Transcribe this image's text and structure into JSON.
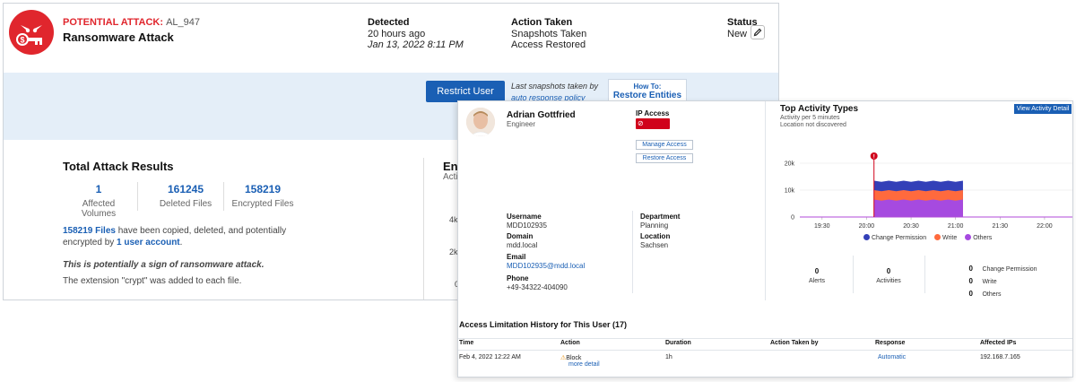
{
  "alert": {
    "type_label": "POTENTIAL ATTACK:",
    "id": "AL_947",
    "title": "Ransomware Attack",
    "detected_label": "Detected",
    "detected_relative": "20 hours ago",
    "detected_datetime": "Jan 13, 2022 8:11 PM",
    "action_label": "Action Taken",
    "action_lines": [
      "Snapshots Taken",
      "Access Restored"
    ],
    "status_label": "Status",
    "status_value": "New",
    "restrict_button": "Restrict User",
    "snapshot_note": "Last snapshots taken by",
    "snapshot_link": "auto response policy",
    "howto_label": "How To:",
    "howto_link": "Restore Entities",
    "icon_color": "#e0262d"
  },
  "results": {
    "title": "Total Attack Results",
    "stats": [
      {
        "value": "1",
        "caption": "Affected Volumes"
      },
      {
        "value": "161245",
        "caption": "Deleted Files"
      },
      {
        "value": "158219",
        "caption": "Encrypted Files"
      }
    ],
    "summary_files": "158219 Files",
    "summary_text": " have been copied, deleted, and potentially encrypted by ",
    "summary_account": "1 user account",
    "summary_end": ".",
    "warning": "This is potentially a sign of ransomware attack.",
    "extension_note": "The extension \"crypt\" was added to each file.",
    "enc_title": "Enc",
    "enc_sub": "Acti",
    "enc_ticks": [
      "4k",
      "2k",
      "0"
    ]
  },
  "user": {
    "name": "Adrian Gottfried",
    "role": "Engineer",
    "ip_access_label": "IP Access",
    "ip_status": "Blocked",
    "manage_button": "Manage Access",
    "restore_button": "Restore Access",
    "fields": {
      "username_label": "Username",
      "username": "MDD102935",
      "domain_label": "Domain",
      "domain": "mdd.local",
      "email_label": "Email",
      "email": "MDD102935@mdd.local",
      "phone_label": "Phone",
      "phone": "+49-34322-404090",
      "department_label": "Department",
      "department": "Planning",
      "location_label": "Location",
      "location": "Sachsen"
    }
  },
  "activity": {
    "title": "Top Activity Types",
    "subtitle1": "Activity per 5 minutes",
    "subtitle2": "Location not discovered",
    "view_button": "View Activity Detail",
    "counts": [
      {
        "value": "0",
        "caption": "Alerts"
      },
      {
        "value": "0",
        "caption": "Activities"
      }
    ],
    "breakdown": [
      {
        "value": "0",
        "label": "Change Permission"
      },
      {
        "value": "0",
        "label": "Write"
      },
      {
        "value": "0",
        "label": "Others"
      }
    ]
  },
  "chart_data": {
    "type": "area",
    "title": "Top Activity Types",
    "x": [
      "19:30",
      "20:00",
      "20:30",
      "21:00",
      "21:30",
      "22:00"
    ],
    "ylim": [
      0,
      20000
    ],
    "y_ticks": [
      "20k",
      "10k",
      "0"
    ],
    "x_ticks": [
      "19:30",
      "20:00",
      "20:30",
      "21:00",
      "21:30",
      "22:00"
    ],
    "series": [
      {
        "name": "Change Permission",
        "color": "#3340b8",
        "start": "20:05",
        "end": "21:05",
        "value_top": 13500
      },
      {
        "name": "Write",
        "color": "#ff6a3d",
        "start": "20:05",
        "end": "21:05",
        "value_top": 10000
      },
      {
        "name": "Others",
        "color": "#a64ae0",
        "start": "20:05",
        "end": "21:05",
        "value_top": 6500
      }
    ],
    "marker": {
      "time": "20:05",
      "label": "!",
      "color": "#d0021b"
    },
    "legend": "bottom"
  },
  "history": {
    "title": "Access Limitation History for This User (17)",
    "columns": [
      "Time",
      "Action",
      "Duration",
      "Action Taken by",
      "Response",
      "Affected IPs"
    ],
    "rows": [
      {
        "time": "Feb 4, 2022 12:22 AM",
        "action": "Block",
        "action_link": "more detail",
        "duration": "1h",
        "taken_by": "",
        "response": "Automatic",
        "ips": "192.168.7.165"
      }
    ]
  }
}
